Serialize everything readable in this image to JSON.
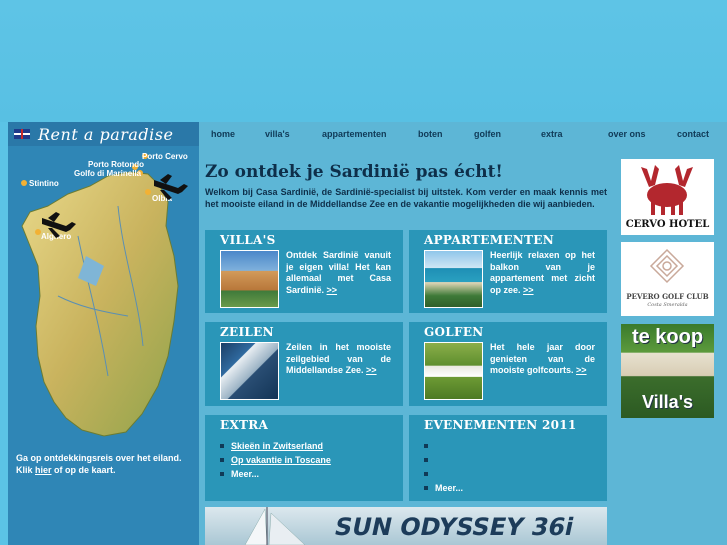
{
  "brand": {
    "title": "Rent a paradise"
  },
  "map": {
    "places": [
      "Porto Cervo",
      "Porto Rotondo",
      "Golfo di Marinella",
      "Stintino",
      "Olbia",
      "Alghero"
    ],
    "caption_pre": "Ga op ontdekkingsreis over het eiland. Klik ",
    "caption_link": "hier",
    "caption_post": " of op de kaart."
  },
  "nav": {
    "items": [
      "home",
      "villa's",
      "appartementen",
      "boten",
      "golfen",
      "extra",
      "over ons",
      "contact"
    ]
  },
  "main": {
    "headline": "Zo ontdek je Sardinië pas écht!",
    "intro": "Welkom bij Casa Sardinië, de Sardinië-specialist bij uitstek. Kom verder en maak kennis met het mooiste eiland in de Middellandse Zee en de vakantie mogelijkheden die wij aanbieden.",
    "boxes": [
      {
        "title": "VILLA'S",
        "text": "Ontdek Sardinië vanuit je eigen villa! Het kan allemaal met Casa Sardinië.",
        "more": ">>"
      },
      {
        "title": "APPARTEMENTEN",
        "text": "Heerlijk relaxen op het balkon van je appartement met zicht op zee.",
        "more": ">>"
      },
      {
        "title": "ZEILEN",
        "text": "Zeilen in het mooiste zeilgebied van de Middellandse Zee.",
        "more": ">>"
      },
      {
        "title": "GOLFEN",
        "text": "Het hele jaar door genieten van de mooiste golfcourts.",
        "more": ">>"
      }
    ],
    "extra": {
      "title": "EXTRA",
      "links": [
        "Skieën in Zwitserland",
        "Op vakantie in Toscane",
        "Meer..."
      ]
    },
    "events": {
      "title": "EVENEMENTEN 2011",
      "more": "Meer..."
    },
    "banner": {
      "text": "SUN ODYSSEY 36i"
    }
  },
  "ads": {
    "cervo": "CERVO HOTEL",
    "pevero": "PEVERO GOLF CLUB",
    "pevero_sub": "Costa Smeralda",
    "tekoop_1": "te koop",
    "tekoop_2": "Villa's"
  },
  "colors": {
    "accent": "#2a96b8",
    "nav_text": "#103a57",
    "sea": "#5bc3e6"
  }
}
